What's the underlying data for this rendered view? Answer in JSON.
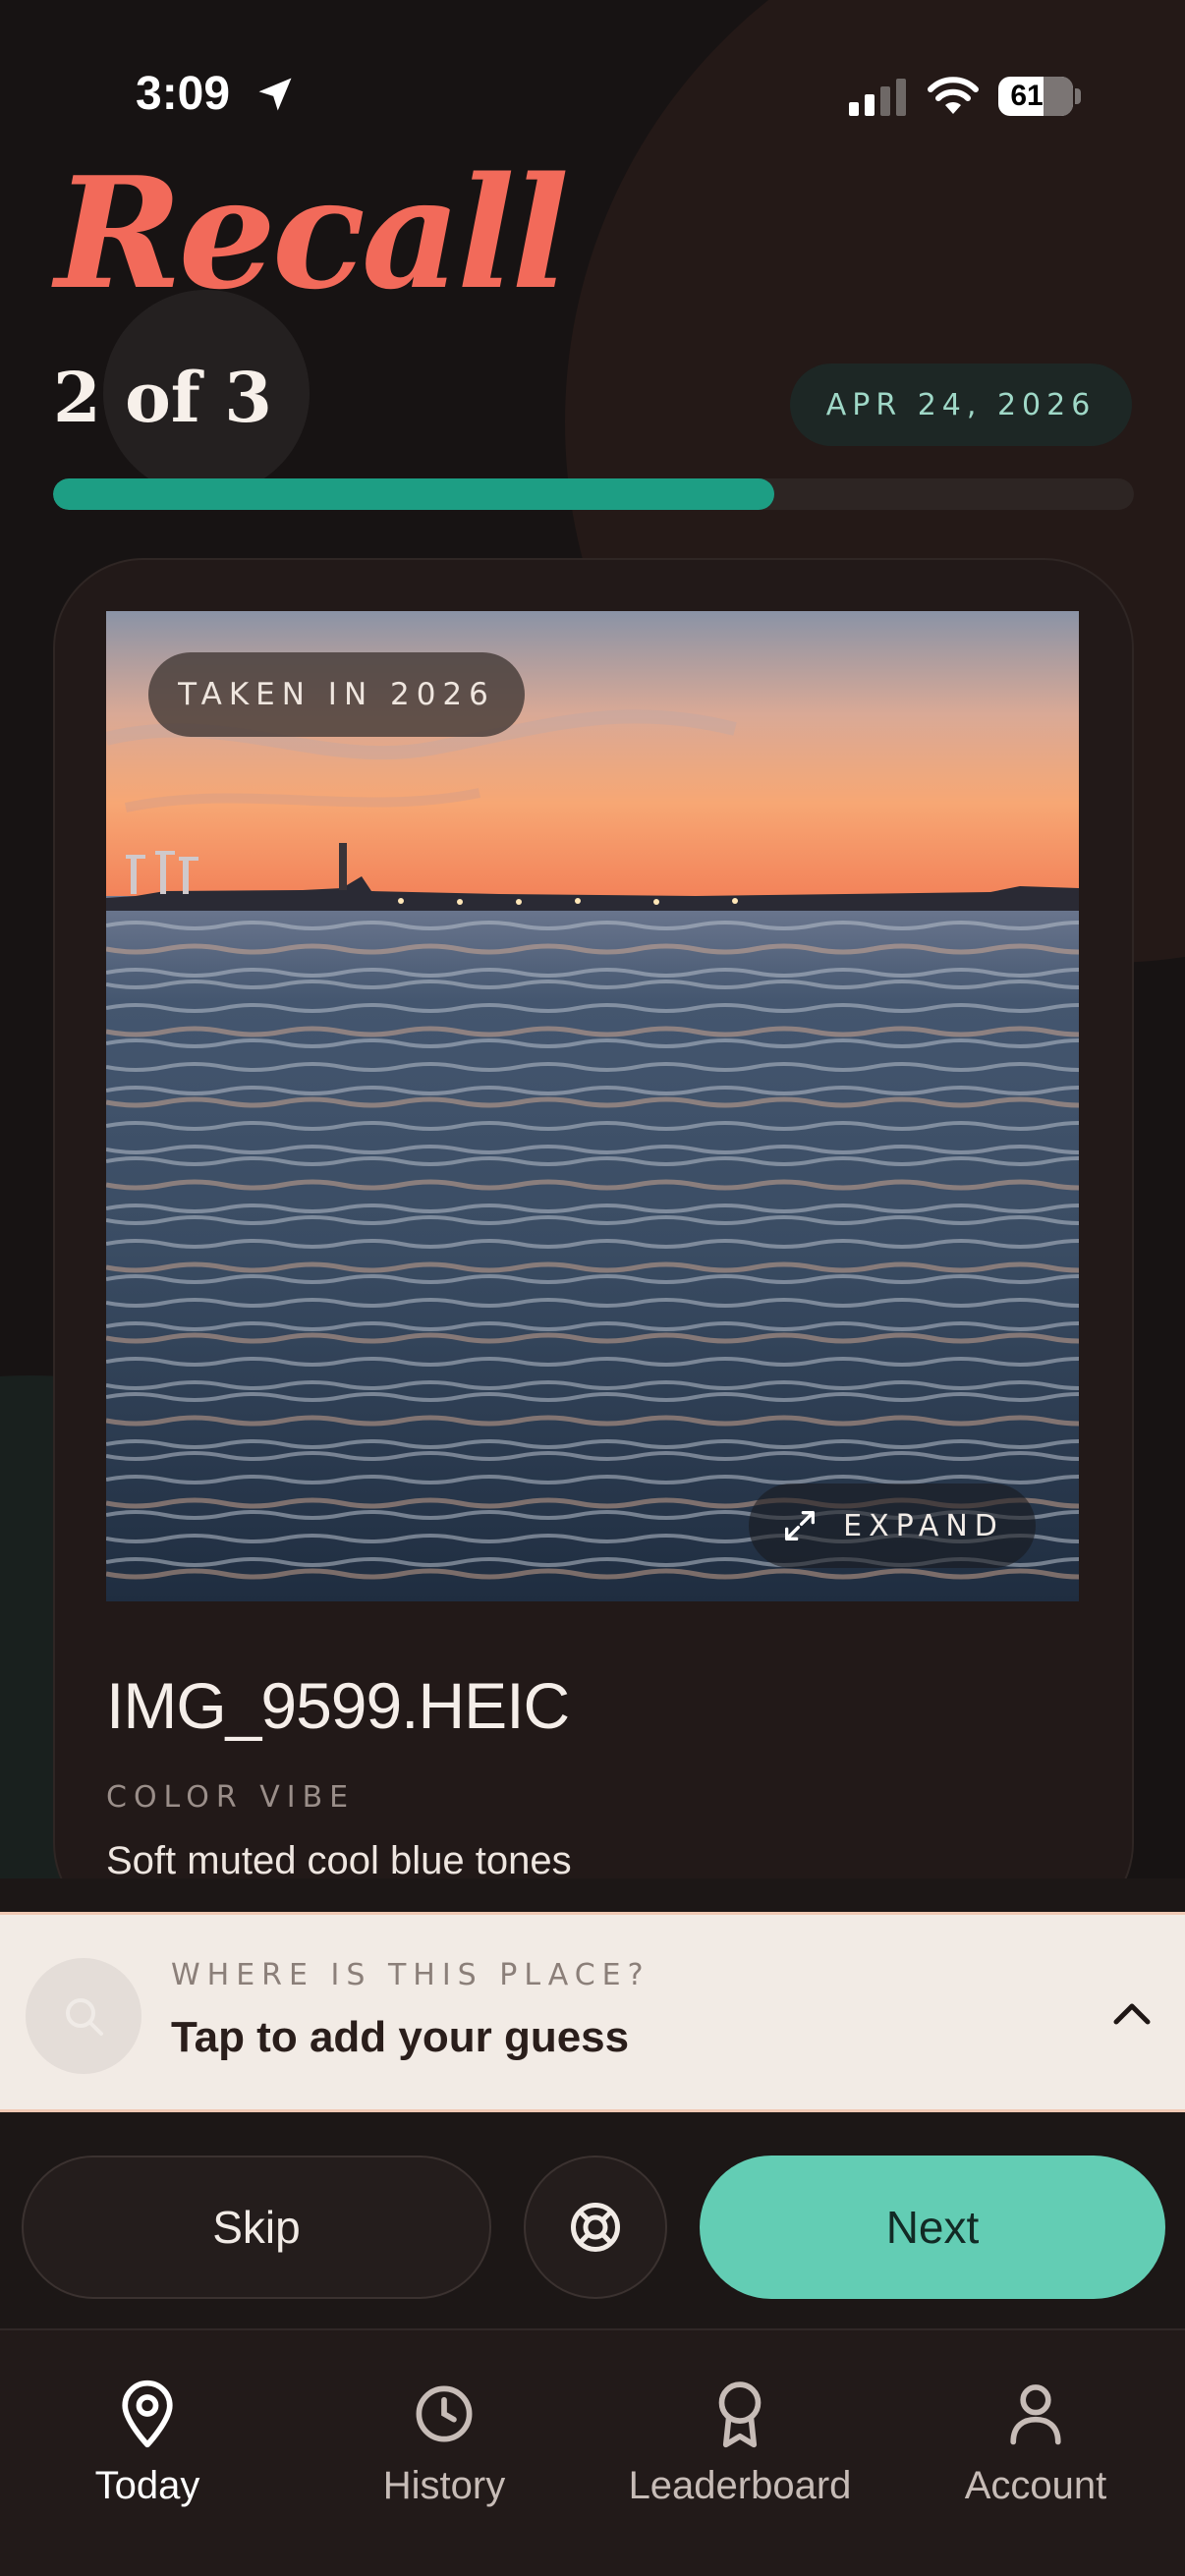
{
  "status_bar": {
    "time": "3:09",
    "battery": "61",
    "icons": [
      "location-arrow-icon",
      "cellular-signal-icon",
      "wifi-icon",
      "battery-icon"
    ]
  },
  "header": {
    "app_title": "Recall",
    "progress_label": "2 of 3",
    "date": "APR 24, 2026",
    "progress_fraction": 0.667
  },
  "card": {
    "photo_tag": "TAKEN IN 2026",
    "expand_label": "EXPAND",
    "filename": "IMG_9599.HEIC",
    "vibe_label": "COLOR VIBE",
    "vibe_value": "Soft muted cool blue tones"
  },
  "guess": {
    "label": "WHERE IS THIS PLACE?",
    "cta": "Tap to add your guess"
  },
  "actions": {
    "skip": "Skip",
    "next": "Next",
    "help_icon": "lifebuoy-icon"
  },
  "tabs": [
    {
      "label": "Today",
      "icon": "map-pin-icon",
      "active": true
    },
    {
      "label": "History",
      "icon": "clock-icon",
      "active": false
    },
    {
      "label": "Leaderboard",
      "icon": "award-icon",
      "active": false
    },
    {
      "label": "Account",
      "icon": "user-icon",
      "active": false
    }
  ],
  "colors": {
    "accent_red": "#f26a5a",
    "accent_teal": "#63cdb4",
    "progress": "#1d9e84",
    "background": "#171313"
  }
}
